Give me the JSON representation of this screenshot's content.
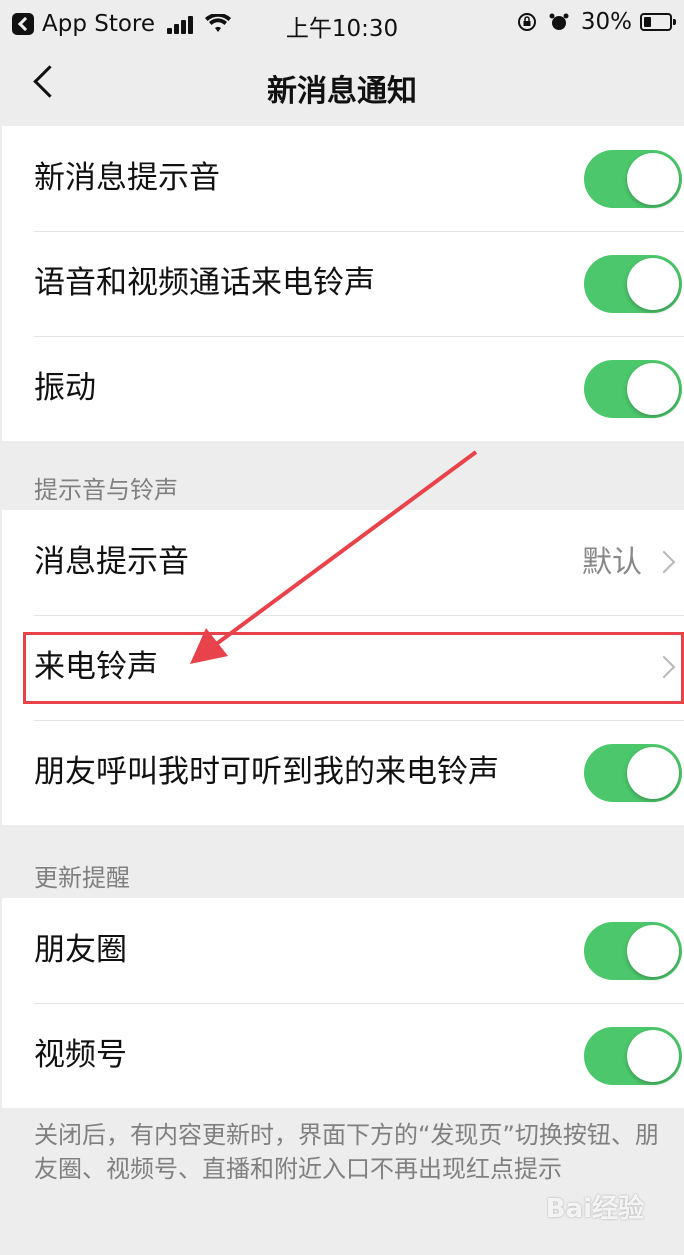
{
  "status_bar": {
    "back_app": "App Store",
    "time": "上午10:30",
    "battery": "30%",
    "battery_level": 0.3
  },
  "nav": {
    "title": "新消息通知"
  },
  "group1": {
    "rows": [
      {
        "label": "新消息提示音",
        "toggle": true
      },
      {
        "label": "语音和视频通话来电铃声",
        "toggle": true
      },
      {
        "label": "振动",
        "toggle": true
      }
    ]
  },
  "section_sound": {
    "header": "提示音与铃声",
    "rows": [
      {
        "label": "消息提示音",
        "value": "默认"
      },
      {
        "label": "来电铃声",
        "value": ""
      },
      {
        "label": "朋友呼叫我时可听到我的来电铃声",
        "toggle": true
      }
    ]
  },
  "section_update": {
    "header": "更新提醒",
    "rows": [
      {
        "label": "朋友圈",
        "toggle": true
      },
      {
        "label": "视频号",
        "toggle": true
      }
    ],
    "footnote": "关闭后，有内容更新时，界面下方的“发现页”切换按钮、朋友圈、视频号、直播和附近入口不再出现红点提示"
  },
  "watermark": "Bai经验",
  "colors": {
    "toggle_on": "#4cc76b",
    "annotation_red": "#e8434a",
    "background": "#ededed"
  }
}
